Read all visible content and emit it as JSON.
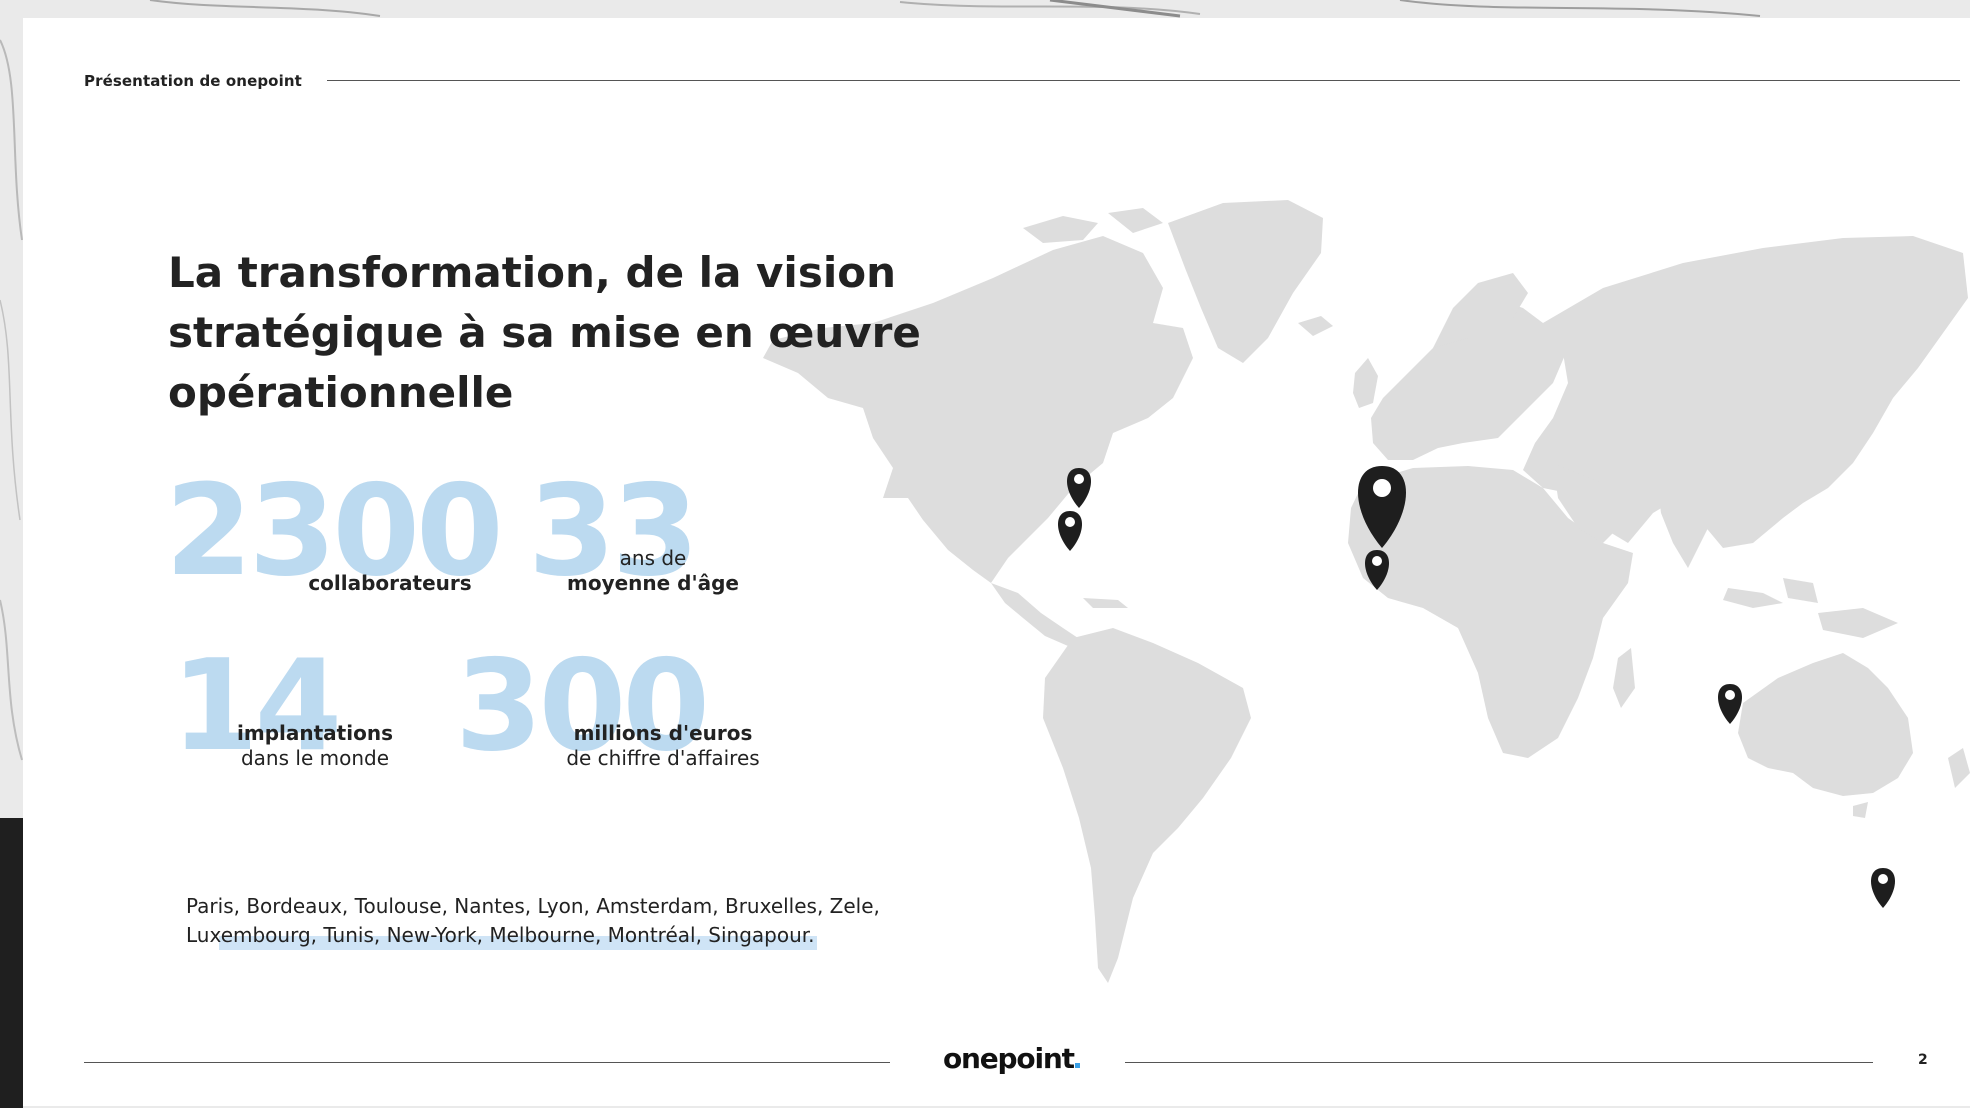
{
  "header": {
    "label": "Présentation de onepoint"
  },
  "title": {
    "lines": [
      "La transformation, de la vision",
      "stratégique à sa mise en œuvre",
      "opérationnelle"
    ]
  },
  "stats": [
    {
      "number": "2300",
      "label_bold": "collaborateurs",
      "label_light": ""
    },
    {
      "number": "33",
      "label_light": "ans de",
      "label_bold": "moyenne d'âge"
    },
    {
      "number": "14",
      "label_bold": "implantations",
      "label_light": "dans le monde"
    },
    {
      "number": "300",
      "label_bold": "millions d'euros",
      "label_light": "de chiffre d'affaires"
    }
  ],
  "cities": {
    "line1": "Paris, Bordeaux, Toulouse, Nantes, Lyon, Amsterdam, Bruxelles, Zele,",
    "line2": "Luxembourg, Tunis, New-York, Melbourne, Montréal, Singapour."
  },
  "footer": {
    "logo": "onepoint",
    "page_number": "2"
  },
  "colors": {
    "stat_number": "#bcdaf0",
    "map_land": "#dddddd",
    "pin": "#1e1e1e",
    "text": "#222222",
    "logo_dot": "#3aa0e6"
  },
  "map": {
    "pins": [
      "montreal-pin",
      "new-york-pin",
      "paris-pin",
      "tunis-pin",
      "singapore-pin",
      "melbourne-pin"
    ]
  }
}
